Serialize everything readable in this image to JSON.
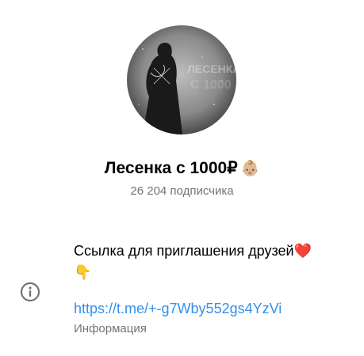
{
  "channel": {
    "title": "Лесенка с 1000₽",
    "title_emoji": "👶🏼",
    "subscribers": "26 204 подписчика",
    "avatar_text": "ЛЕСЕНКА"
  },
  "info": {
    "description_line1": "Ссылка для приглашения друзей",
    "description_emoji1": "❤️",
    "description_emoji2": "👇",
    "link": "https://t.me/+-g7Wby552gs4YzVi",
    "label": "Информация",
    "icon": "info-circle-icon"
  },
  "colors": {
    "accent": "#3390ec",
    "secondary_text": "#707579"
  }
}
